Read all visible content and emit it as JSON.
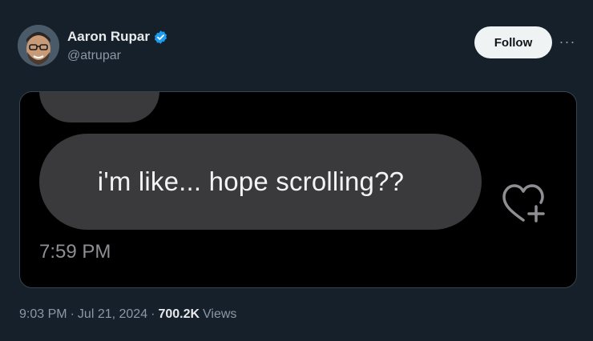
{
  "author": {
    "name": "Aaron Rupar",
    "handle": "@atrupar",
    "verified": true
  },
  "actions": {
    "follow_label": "Follow",
    "more_label": "···"
  },
  "media": {
    "message_text": "i'm like... hope scrolling??",
    "message_time": "7:59 PM",
    "reaction_icon": "heart-plus-icon"
  },
  "meta": {
    "time": "9:03 PM",
    "separator": "·",
    "date": "Jul 21, 2024",
    "views_count": "700.2K",
    "views_label": "Views"
  },
  "colors": {
    "background": "#15202b",
    "verified_badge": "#1d9bf0",
    "bubble": "#3a3a3c",
    "secondary_text": "#8b98a5"
  }
}
